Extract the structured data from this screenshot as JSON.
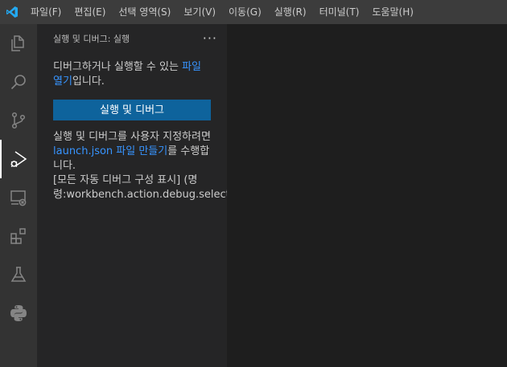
{
  "menu": {
    "items": [
      {
        "label": "파일(F)"
      },
      {
        "label": "편집(E)"
      },
      {
        "label": "선택 영역(S)"
      },
      {
        "label": "보기(V)"
      },
      {
        "label": "이동(G)"
      },
      {
        "label": "실행(R)"
      },
      {
        "label": "터미널(T)"
      },
      {
        "label": "도움말(H)"
      }
    ]
  },
  "activity_bar": {
    "icons": [
      "explorer-icon",
      "search-icon",
      "source-control-icon",
      "run-debug-icon",
      "remote-explorer-icon",
      "extensions-icon",
      "testing-icon",
      "python-icon"
    ],
    "active": "run-debug-icon"
  },
  "sidebar": {
    "title": "실행 및 디버그: 실행",
    "more": "···",
    "intro_text": "디버그하거나 실행할 수 있는 ",
    "intro_link": "파일 열기",
    "intro_suffix": "입니다.",
    "run_button": "실행 및 디버그",
    "custom_text": "실행 및 디버그를 사용자 지정하려면 ",
    "custom_link": "launch.json 파일 만들기",
    "custom_suffix": "를 수행합니다.",
    "auto_line1": "[모든 자동 디버그 구성 표시] (명",
    "auto_line2": "령:workbench.action.debug.selectandst"
  },
  "colors": {
    "titlebar": "#3c3c3c",
    "activity_bar": "#333333",
    "sidebar": "#252526",
    "editor": "#1e1e1e",
    "button": "#0e639c",
    "link": "#3794ff",
    "vscode_blue": "#23a9f2"
  }
}
